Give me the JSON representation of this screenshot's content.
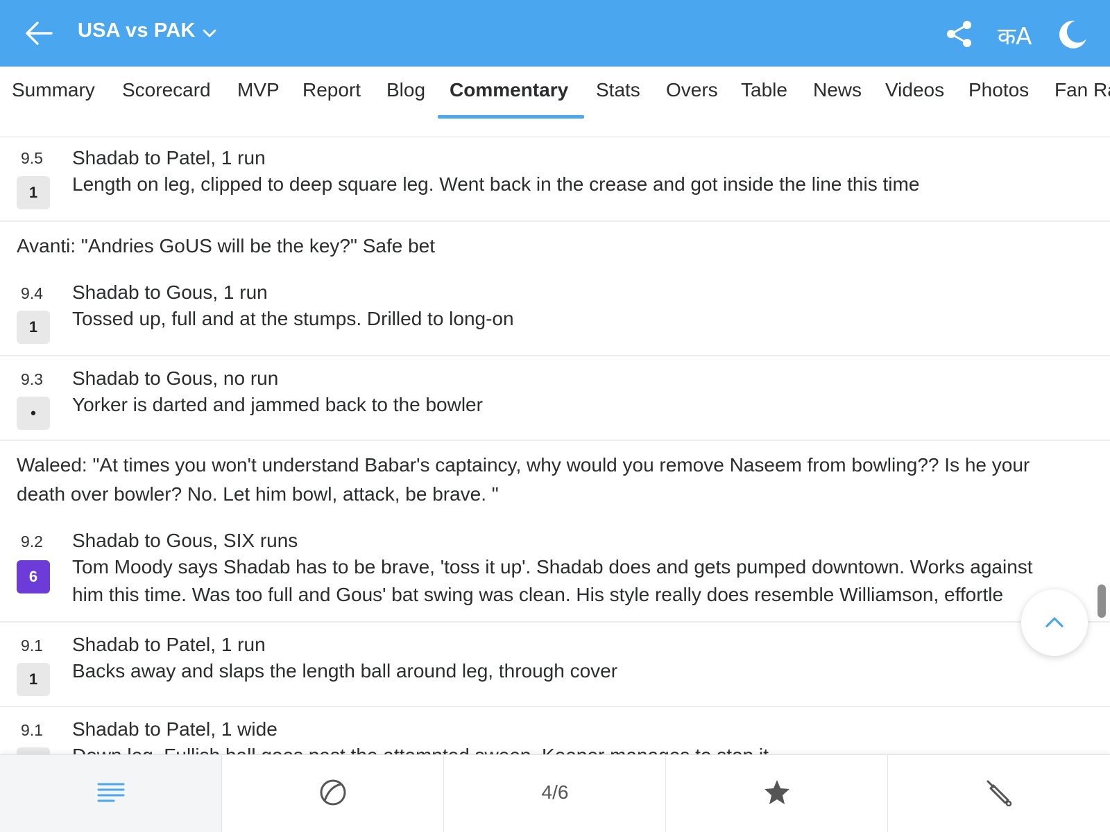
{
  "header": {
    "title": "USA vs PAK",
    "back_icon": "arrow-left-icon",
    "dropdown_icon": "chevron-down-icon",
    "share_icon": "share-icon",
    "language_label": "कA",
    "theme_icon": "moon-icon",
    "bg_color": "#4aa6ee"
  },
  "tabs": [
    {
      "label": "Summary"
    },
    {
      "label": "Scorecard"
    },
    {
      "label": "MVP"
    },
    {
      "label": "Report"
    },
    {
      "label": "Blog"
    },
    {
      "label": "Commentary",
      "active": true
    },
    {
      "label": "Stats"
    },
    {
      "label": "Overs"
    },
    {
      "label": "Table"
    },
    {
      "label": "News"
    },
    {
      "label": "Videos"
    },
    {
      "label": "Photos"
    },
    {
      "label": "Fan Ra"
    }
  ],
  "feed": {
    "balls": [
      {
        "over": "9.5",
        "runs": "1",
        "headline": "Shadab to Patel, 1 run",
        "text": "Length on leg, clipped to deep square leg. Went back in the crease and got inside the line this time"
      },
      {
        "over": "9.4",
        "runs": "1",
        "headline": "Shadab to Gous, 1 run",
        "text": "Tossed up, full and at the stumps. Drilled to long-on",
        "comment_before": "Avanti: \"Andries GoUS will be the key?\" Safe bet"
      },
      {
        "over": "9.3",
        "runs": "•",
        "headline": "Shadab to Gous, no run",
        "text": "Yorker is darted and jammed back to the bowler"
      },
      {
        "over": "9.2",
        "runs": "6",
        "headline": "Shadab to Gous, SIX runs",
        "text": "Tom Moody says Shadab has to be brave, 'toss it up'. Shadab does and gets pumped downtown. Works against him this time. Was too full and Gous' bat swing was clean. His style really does resemble Williamson, effortle",
        "comment_before": "Waleed: \"At times you won't understand Babar's captaincy, why would you remove Naseem from bowling?? Is he your death over bowler? No. Let him bowl, attack, be brave. \"",
        "six_color": "#6c3bd8"
      },
      {
        "over": "9.1",
        "runs": "1",
        "headline": "Shadab to Patel, 1 run",
        "text": "Backs away and slaps the length ball around leg, through cover"
      },
      {
        "over": "9.1",
        "runs": "",
        "headline": "Shadab to Patel, 1 wide",
        "text": "Down leg. Fullish ball goes past the attempted sweep. Keeper manages to stop it"
      }
    ]
  },
  "scroll_top_icon": "chevron-up-icon",
  "bottom_nav": {
    "items": [
      {
        "icon": "list-icon"
      },
      {
        "icon": "ball-icon"
      },
      {
        "label": "4/6"
      },
      {
        "icon": "star-icon"
      },
      {
        "icon": "cricket-bat-icon"
      }
    ]
  }
}
